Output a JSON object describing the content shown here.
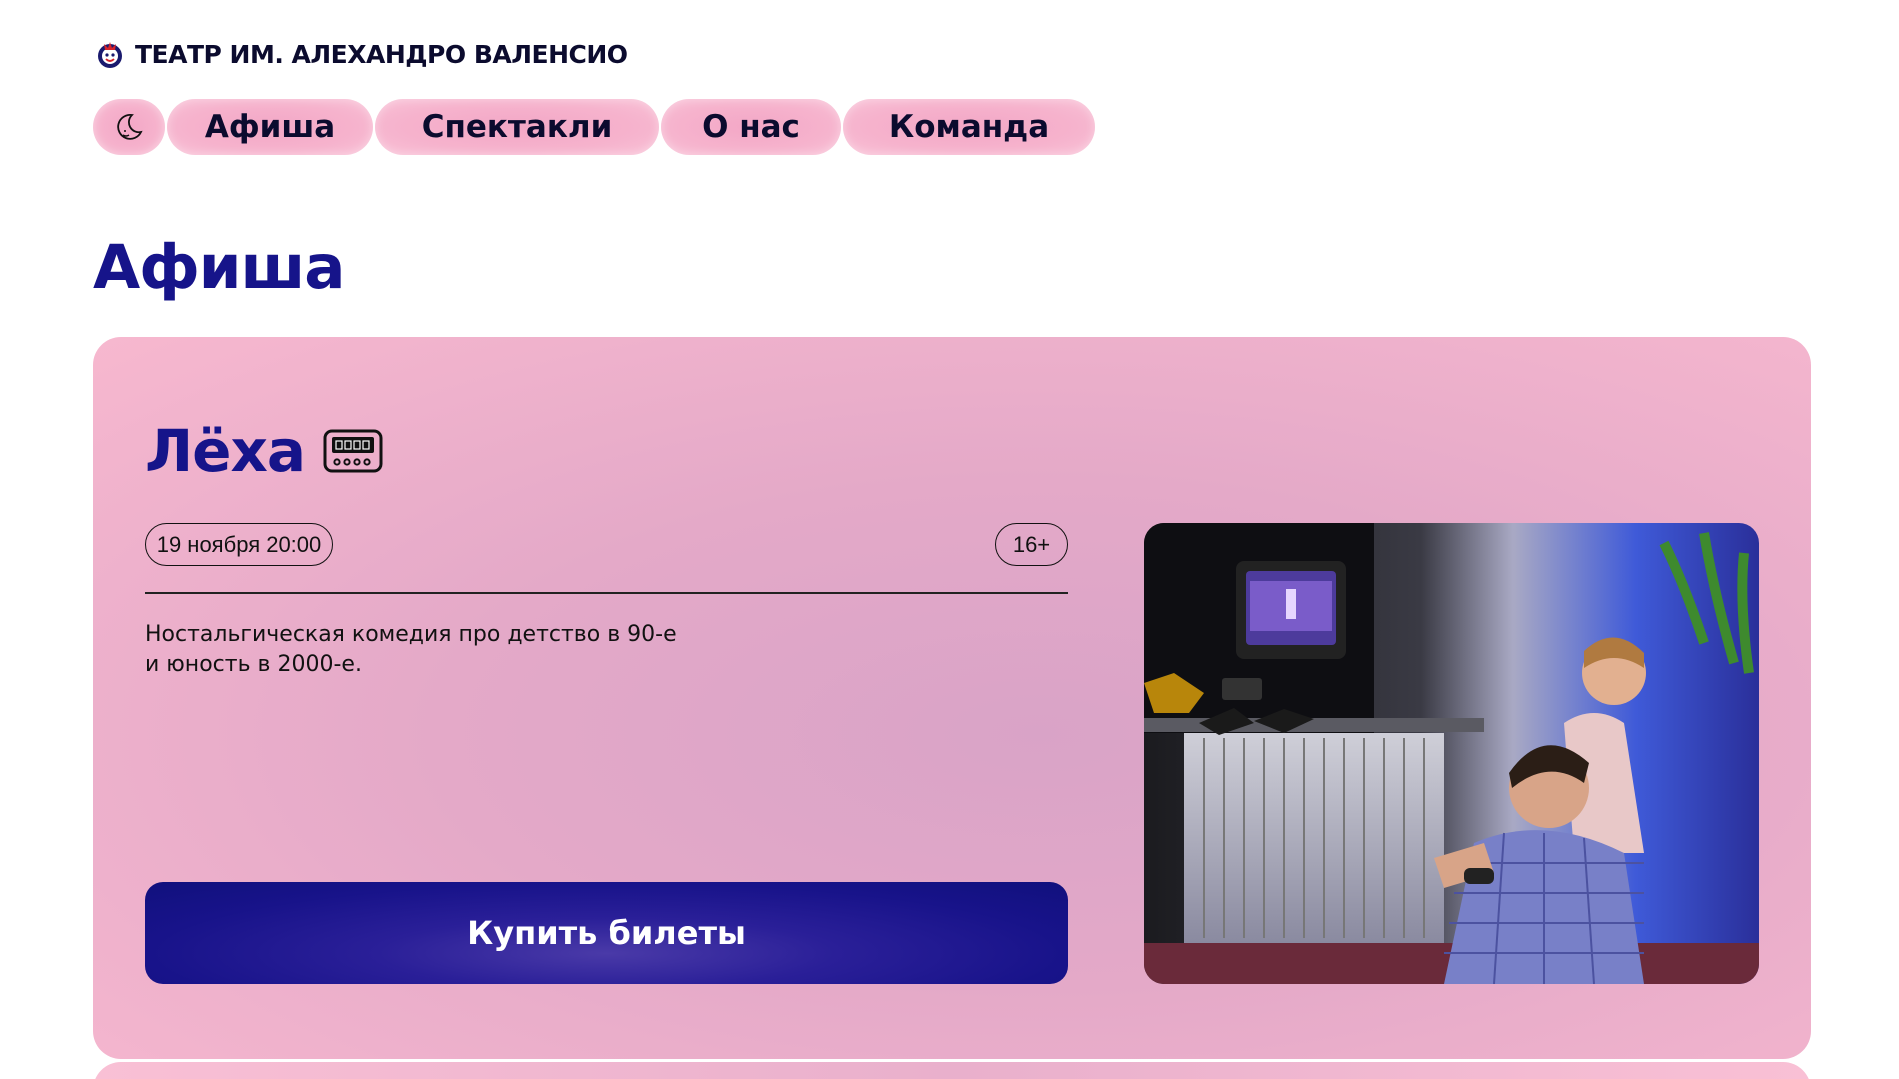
{
  "header": {
    "site_title": "ТЕАТР ИМ. АЛЕХАНДРО ВАЛЕНСИО",
    "logo_icon": "theater-mask-logo-icon"
  },
  "nav": {
    "theme_toggle_icon": "moon-icon",
    "items": [
      {
        "label": "Афиша"
      },
      {
        "label": "Спектакли"
      },
      {
        "label": "О нас"
      },
      {
        "label": "Команда"
      }
    ]
  },
  "page": {
    "title": "Афиша"
  },
  "event": {
    "title": "Лёха",
    "title_icon": "pager-icon",
    "date": "19 ноября 20:00",
    "age_rating": "16+",
    "description_line1": "Ностальгическая комедия про детство в 90-е",
    "description_line2": "и юность в 2000-е.",
    "buy_label": "Купить билеты",
    "photo_icon": "show-photo-two-men-playing-video-games"
  },
  "colors": {
    "accent": "#16148a",
    "card_pink": "#f7b8cf",
    "nav_pink": "#f6b3cd",
    "button_blue": "#18138a"
  }
}
